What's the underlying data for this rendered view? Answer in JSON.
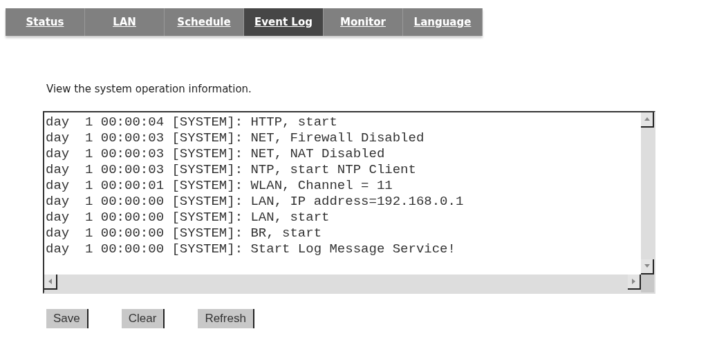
{
  "tabs": [
    {
      "label": "Status",
      "selected": false
    },
    {
      "label": "LAN",
      "selected": false
    },
    {
      "label": "Schedule",
      "selected": false
    },
    {
      "label": "Event Log",
      "selected": true
    },
    {
      "label": "Monitor",
      "selected": false
    },
    {
      "label": "Language",
      "selected": false
    }
  ],
  "description": "View the system operation information.",
  "log_lines": [
    "day  1 00:00:04 [SYSTEM]: HTTP, start",
    "day  1 00:00:03 [SYSTEM]: NET, Firewall Disabled",
    "day  1 00:00:03 [SYSTEM]: NET, NAT Disabled",
    "day  1 00:00:03 [SYSTEM]: NTP, start NTP Client",
    "day  1 00:00:01 [SYSTEM]: WLAN, Channel = 11",
    "day  1 00:00:00 [SYSTEM]: LAN, IP address=192.168.0.1",
    "day  1 00:00:00 [SYSTEM]: LAN, start",
    "day  1 00:00:00 [SYSTEM]: BR, start",
    "day  1 00:00:00 [SYSTEM]: Start Log Message Service!"
  ],
  "buttons": [
    "Save",
    "Clear",
    "Refresh"
  ]
}
